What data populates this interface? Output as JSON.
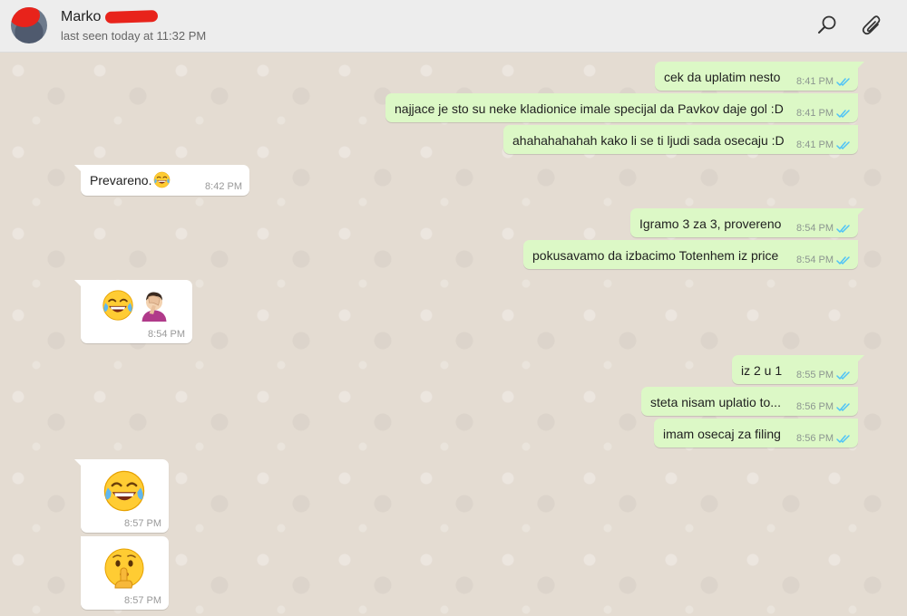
{
  "header": {
    "contact_name": "Marko",
    "last_seen": "last seen today at 11:32 PM"
  },
  "messages": [
    {
      "dir": "out",
      "text": "cek da uplatim nesto",
      "time": "8:41 PM",
      "status": "read"
    },
    {
      "dir": "out",
      "text": "najjace je sto su neke kladionice imale specijal da Pavkov daje gol :D",
      "time": "8:41 PM",
      "status": "read"
    },
    {
      "dir": "out",
      "text": "ahahahahahah kako li se ti ljudi sada osecaju :D",
      "time": "8:41 PM",
      "status": "read"
    },
    {
      "dir": "in",
      "text": "Prevareno.",
      "emoji": "face-with-tears-of-joy",
      "time": "8:42 PM"
    },
    {
      "dir": "out",
      "text": "Igramo 3 za 3, provereno",
      "time": "8:54 PM",
      "status": "read"
    },
    {
      "dir": "out",
      "text": "pokusavamo da izbacimo Totenhem iz price",
      "time": "8:54 PM",
      "status": "read"
    },
    {
      "dir": "in",
      "text": "",
      "emoji": "face-with-tears-of-joy + person-facepalming",
      "time": "8:54 PM"
    },
    {
      "dir": "out",
      "text": "iz 2 u 1",
      "time": "8:55 PM",
      "status": "read"
    },
    {
      "dir": "out",
      "text": "steta nisam uplatio to...",
      "time": "8:56 PM",
      "status": "read"
    },
    {
      "dir": "out",
      "text": "imam osecaj za filing",
      "time": "8:56 PM",
      "status": "read"
    },
    {
      "dir": "in",
      "text": "",
      "emoji": "face-with-tears-of-joy",
      "time": "8:57 PM"
    },
    {
      "dir": "in",
      "text": "",
      "emoji": "shushing-face",
      "time": "8:57 PM"
    }
  ],
  "colors": {
    "outgoing_bubble": "#dcf8c6",
    "incoming_bubble": "#ffffff",
    "read_tick": "#4fc3f7",
    "header_bg": "#ededed",
    "chat_bg": "#e4dcd2"
  }
}
